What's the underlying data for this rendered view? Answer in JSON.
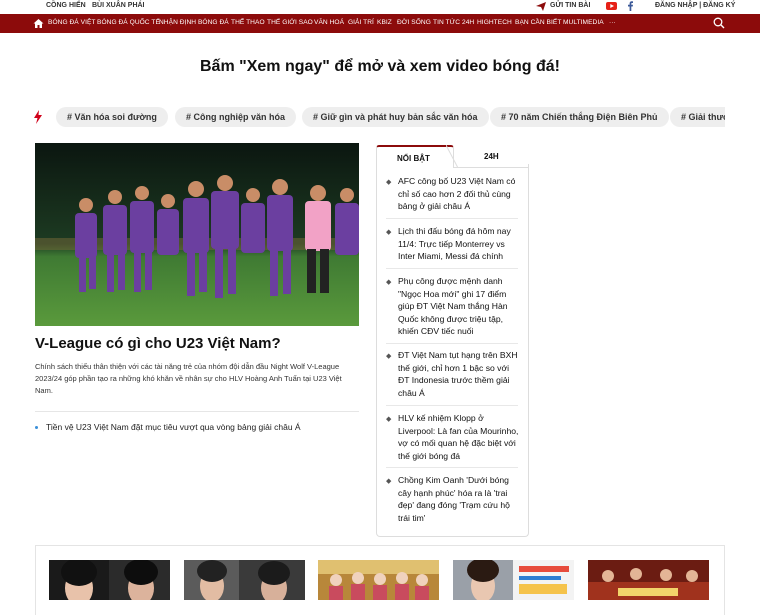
{
  "topbar": {
    "left_links": [
      "CỒNG HIẾN",
      "BÙI XUÂN PHÁI"
    ],
    "send_news": "GỬI TIN BÀI",
    "auth": "ĐĂNG NHẬP | ĐĂNG KÝ"
  },
  "nav": {
    "items": [
      "BÓNG ĐÁ VIỆT",
      "BÓNG ĐÁ QUỐC TẾ",
      "NHẬN ĐỊNH BÓNG ĐÁ",
      "THỂ THAO",
      "THẾ GIỚI SAO",
      "VĂN HOÁ",
      "GIẢI TRÍ",
      "KBIZ",
      "ĐỜI SỐNG",
      "TIN TỨC 24H",
      "HIGHTECH",
      "BẠN CẦN BIẾT",
      "MULTIMEDIA",
      "···"
    ],
    "accent": "#8c0b0b"
  },
  "promo": {
    "text": "Bấm \"Xem ngay\" để mở và xem video bóng đá!"
  },
  "tags": [
    "# Văn hóa soi đường",
    "# Công nghiệp văn hóa",
    "# Giữ gìn và phát huy bản sắc văn hóa",
    "# 70 năm Chiến thắng Điện Biên Phủ",
    "# Giải thưởng"
  ],
  "hero": {
    "title": "V-League có gì cho U23 Việt Nam?",
    "sapo": "Chính sách thiếu thân thiện với các tài năng trẻ của nhóm đội dẫn đầu Night Wolf V-League 2023/24 góp phần tạo ra những khó khăn về nhân sự cho HLV Hoàng Anh Tuấn tại U23 Việt Nam.",
    "related": "Tiền vệ U23 Việt Nam đặt mục tiêu vượt qua vòng bảng giải châu Á"
  },
  "tabs": {
    "featured": "NỔI BẬT",
    "latest": "24H"
  },
  "news": [
    "AFC công bố U23 Việt Nam có chỉ số cao hơn 2 đối thủ cùng bảng ở giải châu Á",
    "Lịch thi đấu bóng đá hôm nay 11/4: Trực tiếp Monterrey vs Inter Miami, Messi đá chính",
    "Phụ công được mệnh danh \"Ngọc Hoa mới\" ghi 17 điểm giúp ĐT Việt Nam thắng Hàn Quốc không được triệu tập, khiến CĐV tiếc nuối",
    "ĐT Việt Nam tụt hạng trên BXH thế giới, chỉ hơn 1 bậc so với ĐT Indonesia trước thềm giải châu Á",
    "HLV kế nhiệm Klopp ở Liverpool: Là fan của Mourinho, vợ có mối quan hệ đặc biệt với thế giới bóng đá",
    "Chồng Kim Oanh 'Dưới bóng cây hạnh phúc' hóa ra là 'trai đẹp' đang đóng 'Trạm cứu hộ trái tim'"
  ]
}
